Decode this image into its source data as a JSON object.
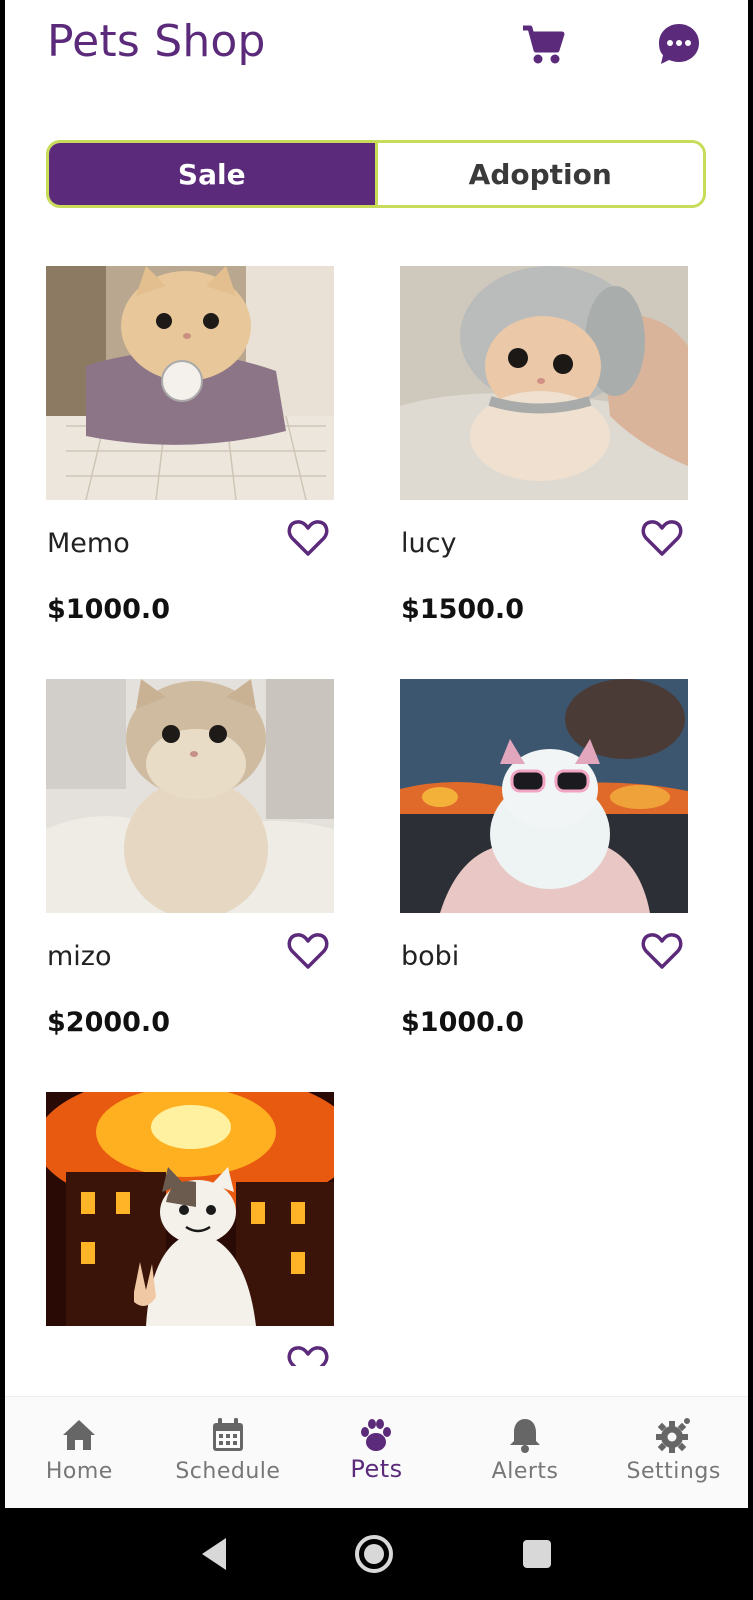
{
  "header": {
    "title": "Pets Shop",
    "cart_icon": "shopping-cart-icon",
    "chat_icon": "chat-bubble-icon"
  },
  "toggle": {
    "sale_label": "Sale",
    "adoption_label": "Adoption",
    "active": "Sale"
  },
  "pets": [
    {
      "name": "Memo",
      "price": "$1000.0",
      "photo": "cream cat in lilac dress on bed"
    },
    {
      "name": "lucy",
      "price": "$1500.0",
      "photo": "cream cat in grey knit hat"
    },
    {
      "name": "mizo",
      "price": "$2000.0",
      "photo": "beige cat sitting on white bedding"
    },
    {
      "name": "bobi",
      "price": "$1000.0",
      "photo": "white cat with pink bow and sunglasses, fire background"
    },
    {
      "name": "",
      "price": "",
      "photo": "cat in front of burning building"
    }
  ],
  "nav": [
    {
      "label": "Home",
      "icon": "home-icon"
    },
    {
      "label": "Schedule",
      "icon": "calendar-icon"
    },
    {
      "label": "Pets",
      "icon": "paw-icon",
      "active": true
    },
    {
      "label": "Alerts",
      "icon": "bell-icon"
    },
    {
      "label": "Settings",
      "icon": "gear-icon"
    }
  ],
  "colors": {
    "primary": "#5b2a7a",
    "toggle_border": "#c8dc5a"
  }
}
